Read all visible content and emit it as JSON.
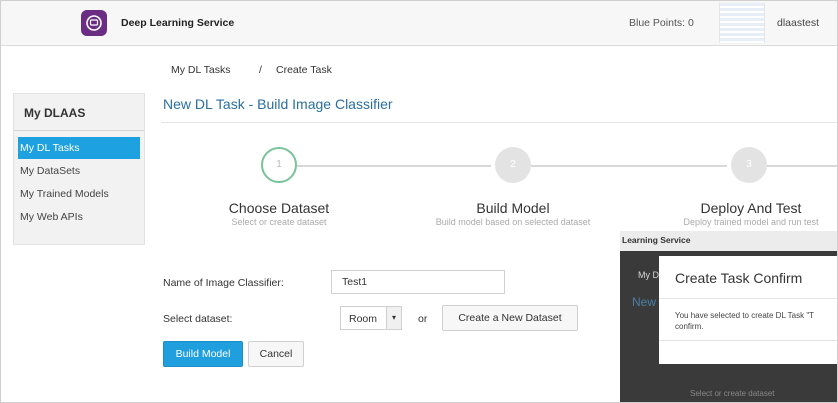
{
  "header": {
    "app_title": "Deep Learning Service",
    "points_label": "Blue Points: 0",
    "user": "dlaastest"
  },
  "sidebar": {
    "title": "My DLAAS",
    "items": [
      {
        "label": "My DL Tasks",
        "active": true
      },
      {
        "label": "My DataSets",
        "active": false
      },
      {
        "label": "My Trained Models",
        "active": false
      },
      {
        "label": "My Web APIs",
        "active": false
      }
    ]
  },
  "breadcrumb": {
    "root": "My DL Tasks",
    "separator": "/",
    "current": "Create Task"
  },
  "page_title": "New DL Task - Build Image Classifier",
  "steps": [
    {
      "number": "1",
      "name": "Choose Dataset",
      "sub": "Select or create dataset",
      "active": true
    },
    {
      "number": "2",
      "name": "Build Model",
      "sub": "Build model based on selected dataset",
      "active": false
    },
    {
      "number": "3",
      "name": "Deploy And Test",
      "sub": "Deploy trained model and run test",
      "active": false
    }
  ],
  "form": {
    "name_label": "Name of Image Classifier:",
    "name_value": "Test1",
    "dataset_label": "Select dataset:",
    "dataset_value": "Room",
    "or_text": "or",
    "create_dataset_label": "Create a New Dataset",
    "build_model_label": "Build Model",
    "cancel_label": "Cancel"
  },
  "overlay": {
    "bar_title": "Learning Service",
    "crumb": "My D",
    "heading": "New",
    "sub": "Select or create dataset",
    "dialog": {
      "title": "Create Task Confirm",
      "text_line1": "You have selected to create DL Task \"T",
      "text_line2": "confirm."
    }
  },
  "colors": {
    "accent": "#1f9fdd",
    "title_blue": "#2a6ea0",
    "step_active_border": "#78c39a"
  }
}
